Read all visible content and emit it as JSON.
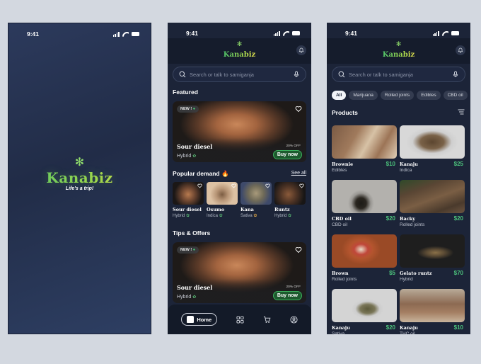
{
  "status_time": "9:41",
  "splash": {
    "brand": "Kanabiz",
    "tagline": "Life's a trip!"
  },
  "home": {
    "brand": "Kanabiz",
    "search_placeholder": "Search or talk to samiganja",
    "featured_title": "Featured",
    "featured": {
      "badge": "NEW !",
      "name": "Sour diesel",
      "type": "Hybrid",
      "discount": "20% OFF",
      "cta": "Buy now"
    },
    "popular_title": "Popular demand 🔥",
    "see_all": "See all",
    "popular": [
      {
        "name": "Sour diesel",
        "type": "Hybrid"
      },
      {
        "name": "Osumo",
        "type": "Indica"
      },
      {
        "name": "Kana",
        "type": "Sativa"
      },
      {
        "name": "Runtz",
        "type": "Hybrid"
      }
    ],
    "tips_title": "Tips & Offers",
    "tips": {
      "badge": "NEW !",
      "name": "Sour diesel",
      "type": "Hybrid",
      "discount": "20% OFF",
      "cta": "Buy now"
    },
    "tabbar": {
      "home": "Home"
    }
  },
  "products": {
    "brand": "Kanabiz",
    "search_placeholder": "Search or talk to samiganja",
    "chips": [
      "All",
      "Marijuana",
      "Rolled joints",
      "Edibles",
      "CBD oil"
    ],
    "active_chip": "All",
    "title": "Products",
    "items": [
      {
        "name": "Brownie",
        "price": "$10",
        "category": "Edibles"
      },
      {
        "name": "Kanaju",
        "price": "$25",
        "category": "Indica"
      },
      {
        "name": "CBD oil",
        "price": "$20",
        "category": "CBD oil"
      },
      {
        "name": "Backy",
        "price": "$20",
        "category": "Rolled joints"
      },
      {
        "name": "Brown",
        "price": "$5",
        "category": "Rolled joints"
      },
      {
        "name": "Gelato runtz",
        "price": "$70",
        "category": "Hybrid"
      },
      {
        "name": "Kanaju",
        "price": "$20",
        "category": "Sativa"
      },
      {
        "name": "Kanaju",
        "price": "$10",
        "category": "THC oil"
      }
    ]
  },
  "colors": {
    "background": "#d3d8e0",
    "screen_bg": "#1c2438",
    "accent_green": "#4cc27c",
    "buy_button": "#1d5a2e"
  }
}
